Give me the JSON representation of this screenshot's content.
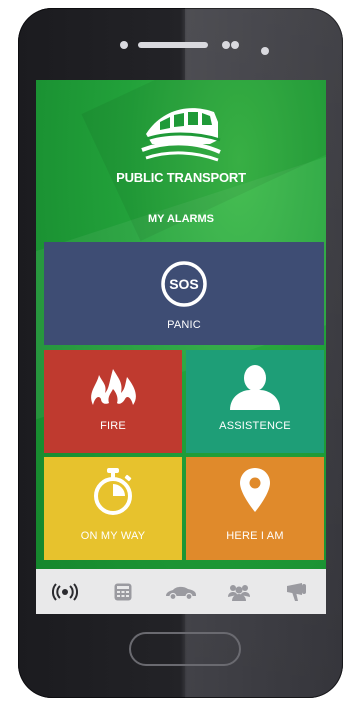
{
  "app": {
    "brand": "PUBLIC TRANSPORT",
    "section_title": "MY ALARMS"
  },
  "tiles": [
    {
      "label": "PANIC",
      "icon": "sos-icon",
      "color": "#3e4d74",
      "icon_text": "SOS"
    },
    {
      "label": "FIRE",
      "icon": "fire-icon",
      "color": "#bf3a2f"
    },
    {
      "label": "ASSISTENCE",
      "icon": "person-icon",
      "color": "#1e9e77"
    },
    {
      "label": "ON MY WAY",
      "icon": "stopwatch-icon",
      "color": "#e7c22d"
    },
    {
      "label": "HERE I AM",
      "icon": "location-pin-icon",
      "color": "#e08a2b"
    }
  ],
  "tabbar": {
    "items": [
      {
        "icon": "broadcast-icon",
        "active": true
      },
      {
        "icon": "calculator-icon",
        "active": false
      },
      {
        "icon": "car-icon",
        "active": false
      },
      {
        "icon": "group-icon",
        "active": false
      },
      {
        "icon": "megaphone-icon",
        "active": false
      }
    ]
  },
  "colors": {
    "screen_green": "#22a13a",
    "tabbar_bg": "#e9e9ea",
    "tab_icon": "#9a9aa0",
    "tab_icon_active": "#2b2b2f"
  }
}
